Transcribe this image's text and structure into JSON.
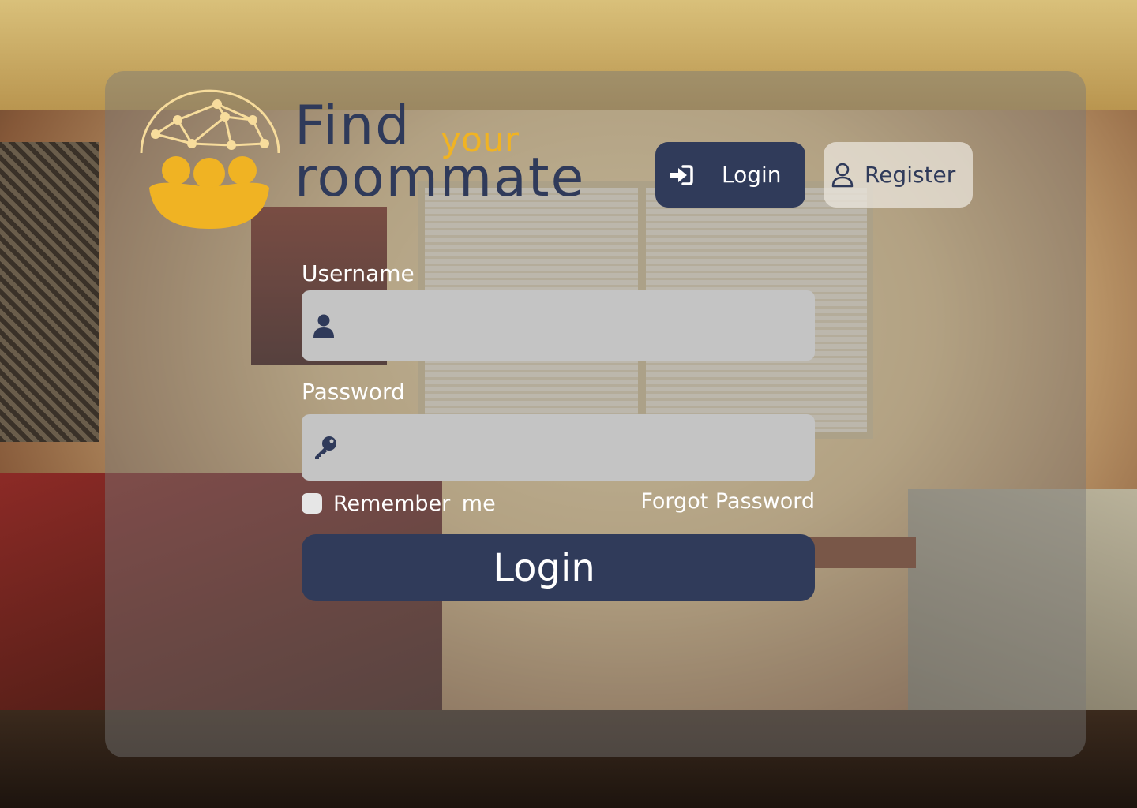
{
  "brand": {
    "line1": "Find",
    "accent": "your",
    "line2": "roommate",
    "primary_color": "#2f3a5a",
    "accent_color": "#f0b323"
  },
  "nav": {
    "login_label": "Login",
    "login_icon": "sign-in-icon",
    "register_label": "Register",
    "register_icon": "user-outline-icon"
  },
  "form": {
    "username_label": "Username",
    "username_value": "",
    "username_icon": "user-icon",
    "password_label": "Password",
    "password_value": "",
    "password_icon": "key-icon",
    "remember_label": "Remember me",
    "remember_checked": false,
    "forgot_label": "Forgot Password",
    "submit_label": "Login"
  }
}
